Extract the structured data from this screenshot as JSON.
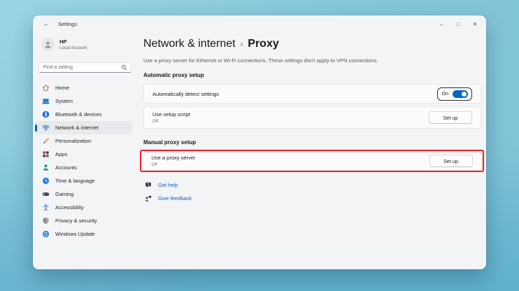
{
  "colors": {
    "accent": "#0067c0",
    "highlight_red": "#e8202a",
    "link": "#0a5dc2"
  },
  "window": {
    "title": "Settings",
    "back_glyph": "←",
    "controls": {
      "minimize": "–",
      "maximize": "□",
      "close": "✕"
    }
  },
  "sidebar": {
    "user": {
      "name": "HP",
      "account_type": "Local Account"
    },
    "search": {
      "placeholder": "Find a setting"
    },
    "items": [
      {
        "label": "Home",
        "icon": "home-icon",
        "selected": false
      },
      {
        "label": "System",
        "icon": "system-icon",
        "selected": false
      },
      {
        "label": "Bluetooth & devices",
        "icon": "bluetooth-icon",
        "selected": false
      },
      {
        "label": "Network & internet",
        "icon": "network-icon",
        "selected": true
      },
      {
        "label": "Personalization",
        "icon": "personalization-icon",
        "selected": false
      },
      {
        "label": "Apps",
        "icon": "apps-icon",
        "selected": false
      },
      {
        "label": "Accounts",
        "icon": "accounts-icon",
        "selected": false
      },
      {
        "label": "Time & language",
        "icon": "time-language-icon",
        "selected": false
      },
      {
        "label": "Gaming",
        "icon": "gaming-icon",
        "selected": false
      },
      {
        "label": "Accessibility",
        "icon": "accessibility-icon",
        "selected": false
      },
      {
        "label": "Privacy & security",
        "icon": "privacy-icon",
        "selected": false
      },
      {
        "label": "Windows Update",
        "icon": "windows-update-icon",
        "selected": false
      }
    ]
  },
  "main": {
    "breadcrumb": {
      "parent": "Network & internet",
      "separator": "›",
      "current": "Proxy"
    },
    "description": "Use a proxy server for Ethernet or Wi-Fi connections. These settings don't apply to VPN connections.",
    "automatic_section": {
      "title": "Automatic proxy setup",
      "detect": {
        "label": "Automatically detect settings",
        "toggle_state": "On"
      },
      "script": {
        "label": "Use setup script",
        "status": "Off",
        "button": "Set up"
      }
    },
    "manual_section": {
      "title": "Manual proxy setup",
      "proxy": {
        "label": "Use a proxy server",
        "status": "Off",
        "button": "Set up"
      }
    },
    "links": [
      {
        "label": "Get help",
        "icon": "help-icon"
      },
      {
        "label": "Give feedback",
        "icon": "feedback-icon"
      }
    ]
  }
}
